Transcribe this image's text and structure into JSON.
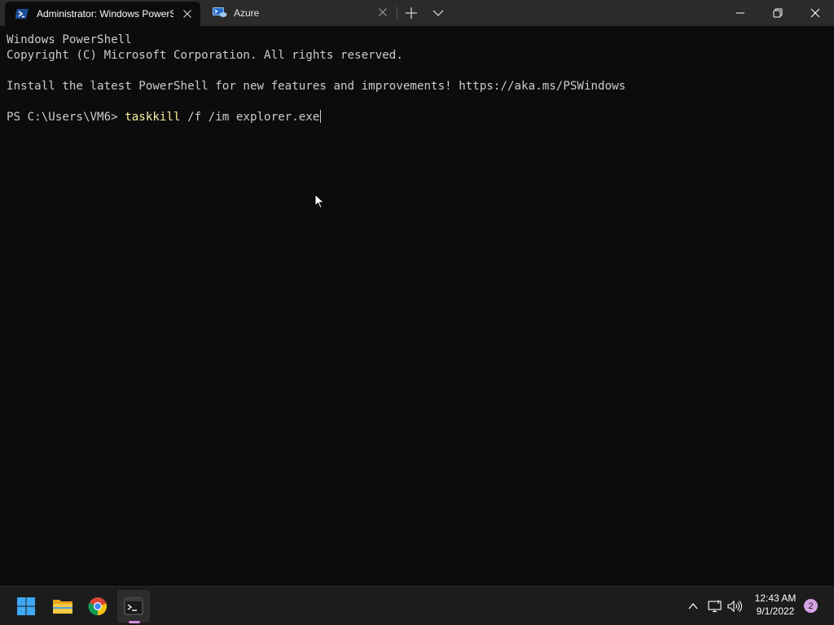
{
  "window": {
    "tabs": [
      {
        "label": "Administrator: Windows PowerShell",
        "icon": "powershell-icon",
        "active": true
      },
      {
        "label": "Azure",
        "icon": "azure-cloud-shell-icon",
        "active": false
      }
    ],
    "new_tab_icon": "plus-icon",
    "dropdown_icon": "chevron-down-icon",
    "controls": [
      "minimize-icon",
      "restore-icon",
      "close-icon"
    ]
  },
  "terminal": {
    "lines": [
      "Windows PowerShell",
      "Copyright (C) Microsoft Corporation. All rights reserved.",
      "",
      "Install the latest PowerShell for new features and improvements! https://aka.ms/PSWindows",
      ""
    ],
    "prompt": "PS C:\\Users\\VM6> ",
    "command": "taskkill",
    "args": " /f /im explorer.exe"
  },
  "taskbar": {
    "apps": [
      "windows-start-icon",
      "file-explorer-icon",
      "chrome-icon",
      "terminal-icon"
    ],
    "tray": [
      "chevron-up-icon",
      "network-icon",
      "volume-icon"
    ],
    "time": "12:43 AM",
    "date": "9/1/2022",
    "notification_count": "2"
  },
  "colors": {
    "background": "#0c0c0c",
    "titlebar": "#2b2b2b",
    "text": "#cccccc",
    "command": "#f9f1a5",
    "taskbar": "#1c1c1c",
    "accent": "#d490e6"
  }
}
